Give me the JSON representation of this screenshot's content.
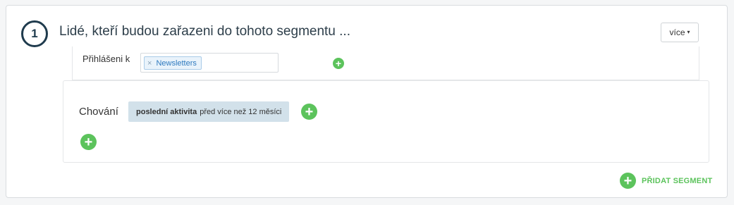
{
  "segment": {
    "number": "1",
    "title": "Lidé, kteří budou zařazeni do tohoto segmentu ...",
    "more_label": "více"
  },
  "subscription": {
    "label": "Přihlášeni k",
    "tags": [
      {
        "remove": "×",
        "label": "Newsletters"
      }
    ]
  },
  "behavior": {
    "label": "Chování",
    "conditions": [
      {
        "bold": "poslední aktivita",
        "rest": "před více než 12 měsíci"
      }
    ]
  },
  "footer": {
    "add_segment_label": "PŘIDAT SEGMENT"
  },
  "icons": {
    "plus": "+",
    "caret": "▾"
  },
  "colors": {
    "accent_green": "#5cc35c",
    "step_navy": "#1f3b4d",
    "chip_blue": "#2f7abf",
    "pill_bg": "#d2e1ea"
  }
}
